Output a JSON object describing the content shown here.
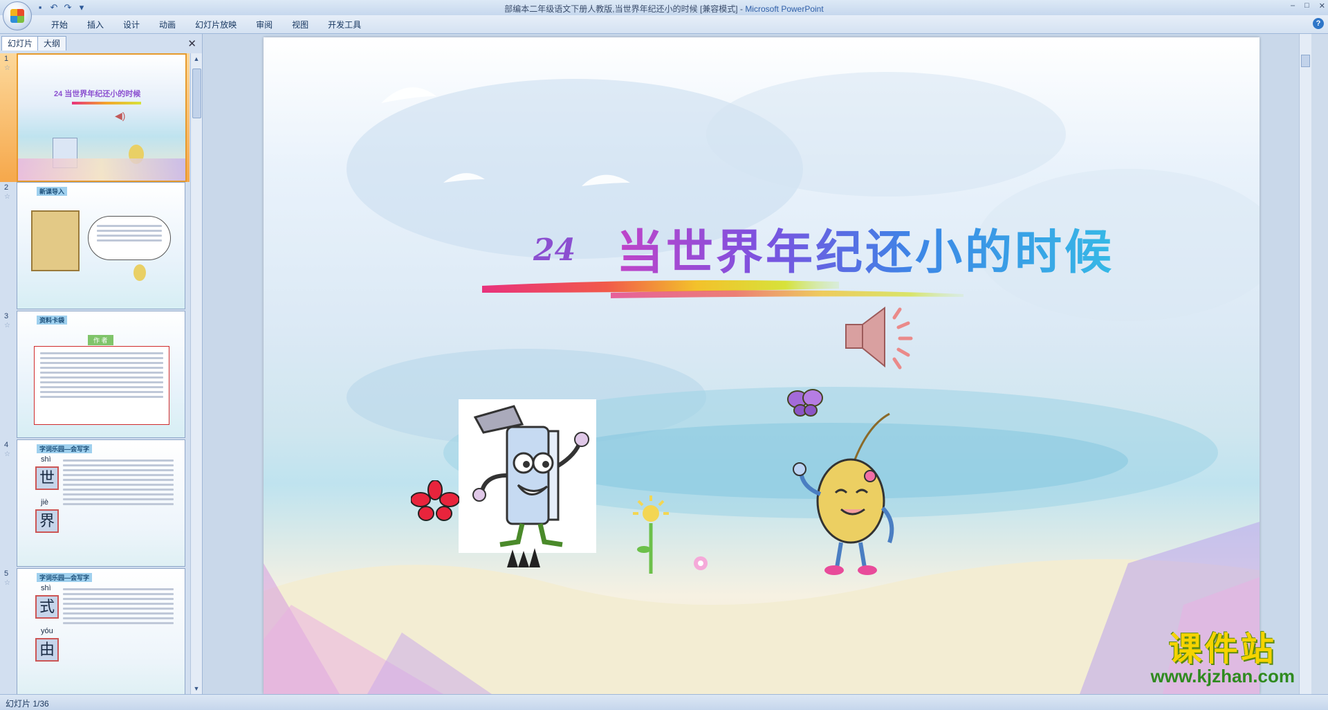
{
  "window": {
    "title": "部编本二年级语文下册人教版,当世界年纪还小的时候 [兼容模式]",
    "app_name": "Microsoft PowerPoint",
    "separator": " - ",
    "qat_icons": [
      "save-icon",
      "undo-icon",
      "redo-icon"
    ],
    "controls": [
      "–",
      "□",
      "✕"
    ]
  },
  "ribbon": {
    "tabs": [
      "开始",
      "插入",
      "设计",
      "动画",
      "幻灯片放映",
      "审阅",
      "视图",
      "开发工具"
    ],
    "help": "?"
  },
  "left_panel": {
    "tab_slides": "幻灯片",
    "tab_outline": "大纲",
    "close": "✕",
    "thumbnails": [
      {
        "number": "1",
        "caption": "",
        "title": "24  当世界年纪还小的时候"
      },
      {
        "number": "2",
        "caption": "新课导入",
        "title": ""
      },
      {
        "number": "3",
        "caption": "资料卡袋",
        "title": "作 者"
      },
      {
        "number": "4",
        "caption": "字词乐园—会写字",
        "title": "",
        "chars": [
          {
            "pinyin": "shì",
            "char": "世"
          },
          {
            "pinyin": "jiè",
            "char": "界"
          }
        ]
      },
      {
        "number": "5",
        "caption": "字词乐园—会写字",
        "title": "",
        "chars": [
          {
            "pinyin": "shì",
            "char": "式"
          },
          {
            "pinyin": "yóu",
            "char": "由"
          }
        ]
      }
    ]
  },
  "slide": {
    "number_label": "24",
    "title": "当世界年纪还小的时候",
    "colors": {
      "title_start": "#c044c8",
      "title_end": "#36b9e6"
    }
  },
  "watermark": {
    "big": "课件站",
    "small": "www.kjzhan.com"
  },
  "status": {
    "slide_counter": "幻灯片 1/36"
  }
}
